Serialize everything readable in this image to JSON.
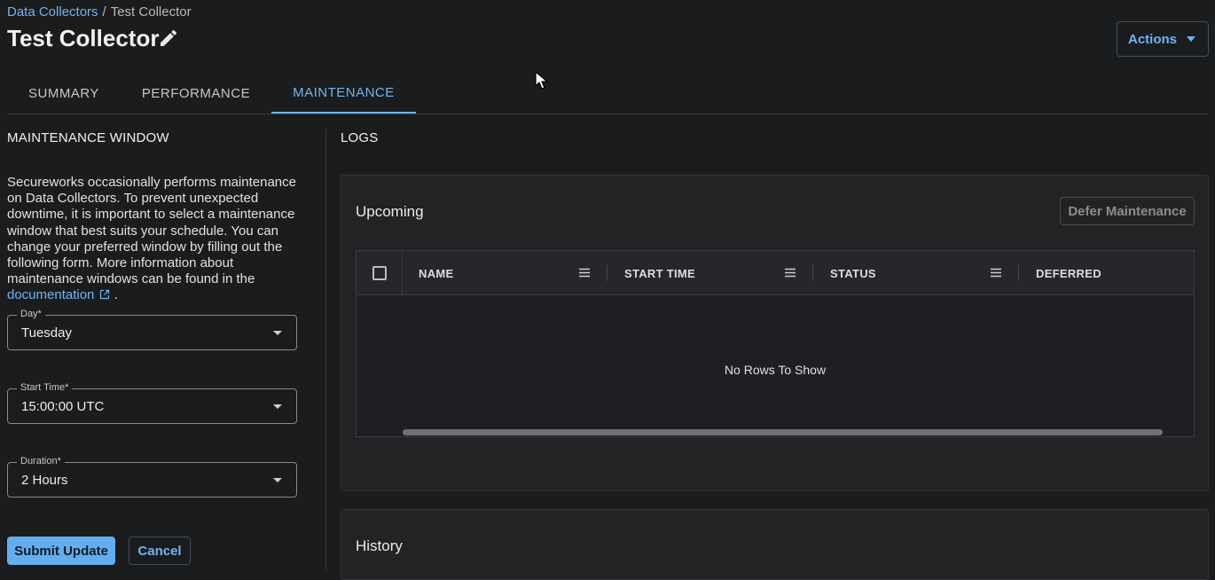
{
  "breadcrumb": {
    "parent": "Data Collectors",
    "separator": "/",
    "current": "Test Collector"
  },
  "page": {
    "title": "Test Collector"
  },
  "header": {
    "actions_label": "Actions"
  },
  "tabs": [
    {
      "label": "SUMMARY",
      "active": false
    },
    {
      "label": "PERFORMANCE",
      "active": false
    },
    {
      "label": "MAINTENANCE",
      "active": true
    }
  ],
  "maintenance_window": {
    "title": "MAINTENANCE WINDOW",
    "description": "Secureworks occasionally performs maintenance on Data Collectors. To prevent unexpected downtime, it is important to select a maintenance window that best suits your schedule. You can change your preferred window by filling out the following form. More information about maintenance windows can be found in the",
    "doc_link": "documentation",
    "desc_end": ".",
    "fields": {
      "day": {
        "label": "Day*",
        "value": "Tuesday"
      },
      "start_time": {
        "label": "Start Time*",
        "value": "15:00:00 UTC"
      },
      "duration": {
        "label": "Duration*",
        "value": "2 Hours"
      }
    },
    "submit_label": "Submit Update",
    "cancel_label": "Cancel"
  },
  "logs": {
    "title": "LOGS",
    "upcoming": {
      "title": "Upcoming",
      "defer_label": "Defer Maintenance",
      "columns": [
        "NAME",
        "START TIME",
        "STATUS",
        "DEFERRED"
      ],
      "empty_text": "No Rows To Show"
    },
    "history": {
      "title": "History"
    }
  },
  "colors": {
    "accent": "#6eb6f4",
    "background": "#1b1c1e",
    "panel": "#222325",
    "primary_button": "#64aef0"
  }
}
